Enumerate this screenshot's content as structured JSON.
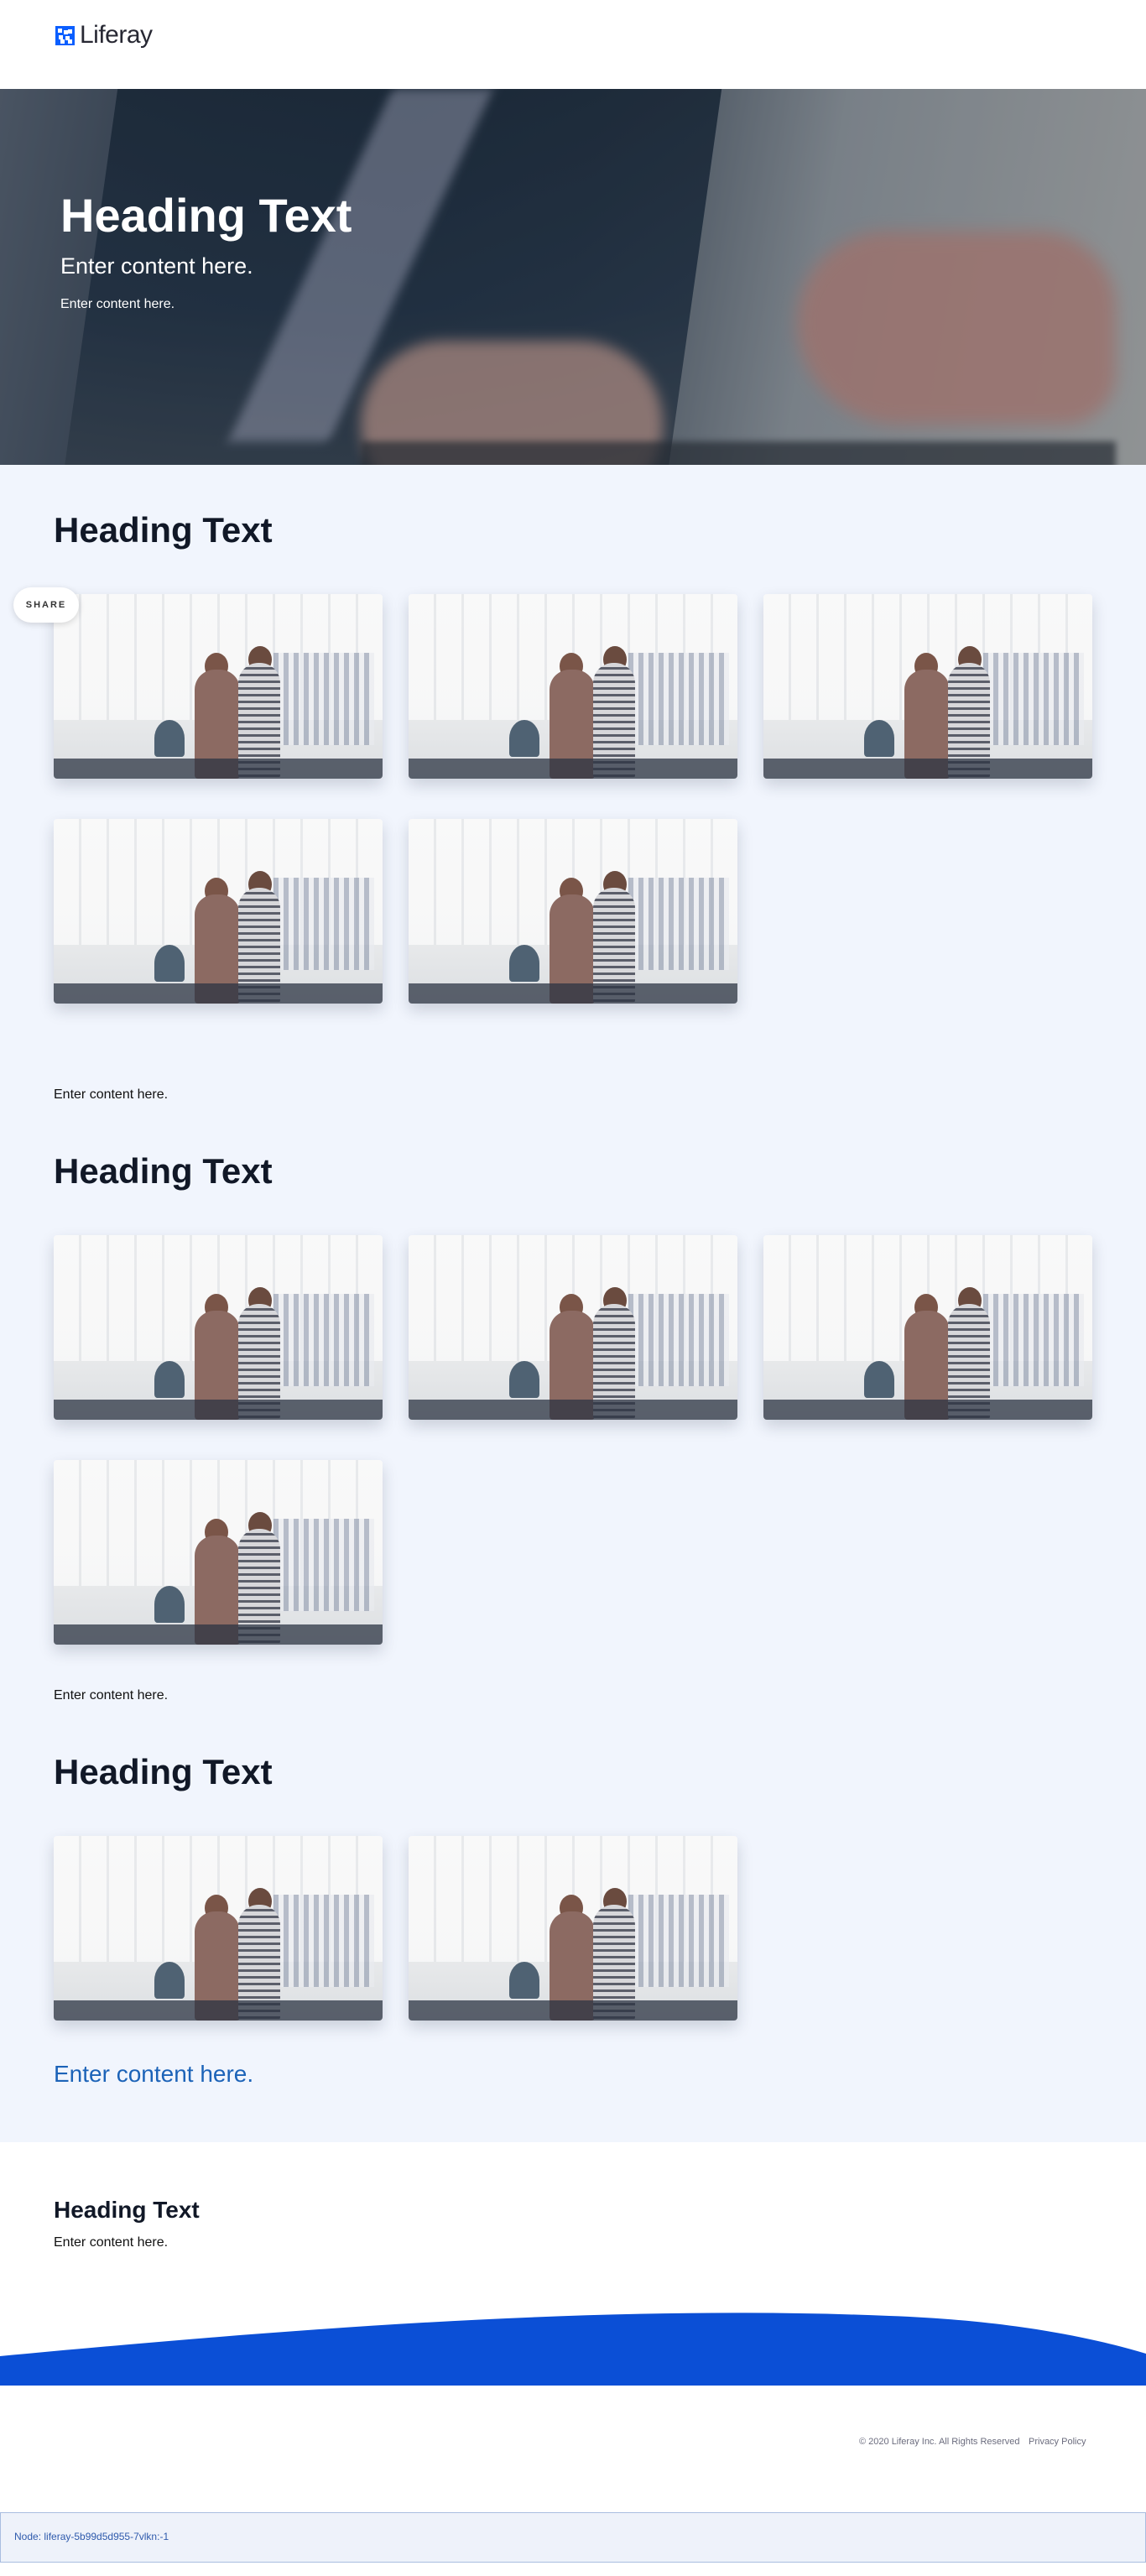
{
  "header": {
    "logo_text": "Liferay"
  },
  "hero": {
    "title": "Heading Text",
    "subtitle": "Enter content here.",
    "small_text": "Enter content here."
  },
  "share": {
    "label": "SHARE"
  },
  "sections": [
    {
      "heading": "Heading Text",
      "card_count": 5,
      "text": "Enter content here."
    },
    {
      "heading": "Heading Text",
      "card_count": 4,
      "text": "Enter content here."
    },
    {
      "heading": "Heading Text",
      "card_count": 2,
      "text": "Enter content here."
    }
  ],
  "footer_block": {
    "heading": "Heading Text",
    "text": "Enter content here."
  },
  "footer": {
    "copyright": "© 2020 Liferay Inc. All Rights Reserved",
    "privacy": "Privacy Policy"
  },
  "node_bar": {
    "text": "Node: liferay-5b99d5d955-7vlkn:-1"
  },
  "colors": {
    "accent": "#0b5fff",
    "wave": "#0b4fd6",
    "content_bg": "#f1f5fd",
    "link": "#1c63b8"
  }
}
